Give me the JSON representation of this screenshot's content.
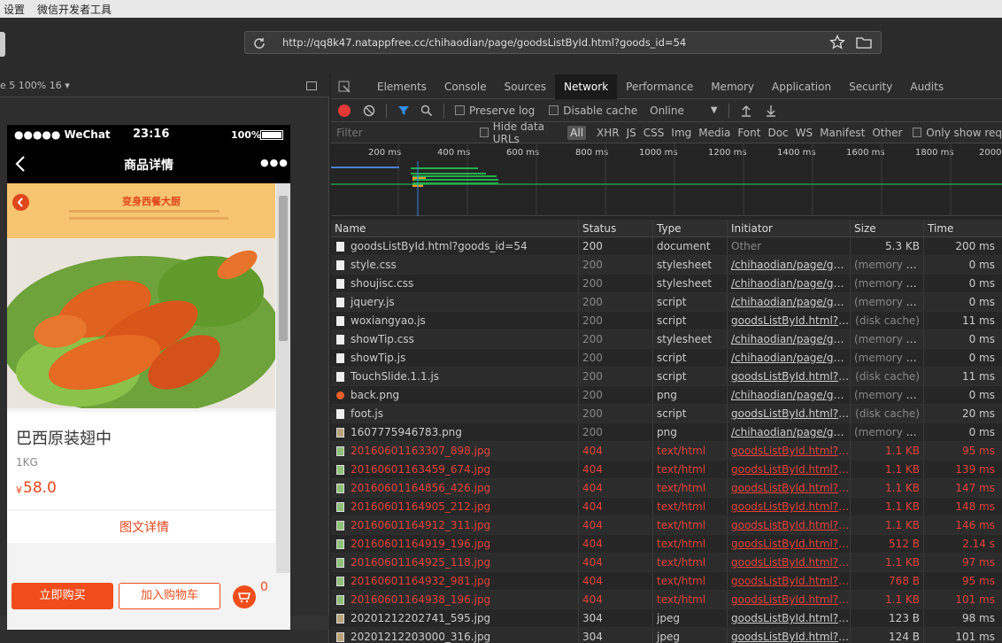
{
  "menubar": {
    "items": [
      "设置",
      "微信开发者工具"
    ]
  },
  "toolbar": {
    "url": "http://qq8k47.natappfree.cc/chihaodian/page/goodsListById.html?goods_id=54"
  },
  "simulator": {
    "device_label": "e 5 100% 16 ▾"
  },
  "phone": {
    "carrier": "●●●●● WeChat",
    "time": "23:16",
    "battery": "100%",
    "nav_title": "商品详情",
    "more": "●●●",
    "banner_title": "变身西餐大厨",
    "product_name": "巴西原装翅中",
    "product_weight": "1KG",
    "currency": "¥",
    "price": "58.0",
    "detail_link": "图文详情",
    "buy_button": "立即购买",
    "cart_button": "加入购物车",
    "cart_count": "0"
  },
  "devtools": {
    "tabs": [
      "Elements",
      "Console",
      "Sources",
      "Network",
      "Performance",
      "Memory",
      "Application",
      "Security",
      "Audits"
    ],
    "active_tab": "Network",
    "preserve_log": "Preserve log",
    "disable_cache": "Disable cache",
    "throttle": "Online",
    "filter_placeholder": "Filter",
    "hide_data_urls": "Hide data URLs",
    "all": "All",
    "types": [
      "XHR",
      "JS",
      "CSS",
      "Img",
      "Media",
      "Font",
      "Doc",
      "WS",
      "Manifest",
      "Other"
    ],
    "only_show": "Only show req",
    "ticks": [
      "200 ms",
      "400 ms",
      "600 ms",
      "800 ms",
      "1000 ms",
      "1200 ms",
      "1400 ms",
      "1600 ms",
      "1800 ms",
      "2000"
    ],
    "columns": [
      "Name",
      "Status",
      "Type",
      "Initiator",
      "Size",
      "Time"
    ],
    "rows": [
      {
        "name": "goodsListById.html?goods_id=54",
        "status": "200",
        "type": "document",
        "initiator": "Other",
        "size": "5.3 KB",
        "time": "200 ms",
        "err": false,
        "icon": "doc",
        "init_link": false,
        "dim": false
      },
      {
        "name": "style.css",
        "status": "200",
        "type": "stylesheet",
        "initiator": "/chihaodian/page/goo...",
        "size": "(memory ca...",
        "time": "0 ms",
        "err": false,
        "icon": "doc",
        "init_link": true,
        "dim": true
      },
      {
        "name": "shoujisc.css",
        "status": "200",
        "type": "stylesheet",
        "initiator": "/chihaodian/page/goo...",
        "size": "(memory ca...",
        "time": "0 ms",
        "err": false,
        "icon": "doc",
        "init_link": true,
        "dim": true
      },
      {
        "name": "jquery.js",
        "status": "200",
        "type": "script",
        "initiator": "/chihaodian/page/goo...",
        "size": "(memory ca...",
        "time": "0 ms",
        "err": false,
        "icon": "doc",
        "init_link": true,
        "dim": true
      },
      {
        "name": "woxiangyao.js",
        "status": "200",
        "type": "script",
        "initiator": "goodsListById.html?g...",
        "size": "(disk cache)",
        "time": "11 ms",
        "err": false,
        "icon": "doc",
        "init_link": true,
        "dim": true
      },
      {
        "name": "showTip.css",
        "status": "200",
        "type": "stylesheet",
        "initiator": "/chihaodian/page/goo...",
        "size": "(memory ca...",
        "time": "0 ms",
        "err": false,
        "icon": "doc",
        "init_link": true,
        "dim": true
      },
      {
        "name": "showTip.js",
        "status": "200",
        "type": "script",
        "initiator": "/chihaodian/page/goo...",
        "size": "(memory ca...",
        "time": "0 ms",
        "err": false,
        "icon": "doc",
        "init_link": true,
        "dim": true
      },
      {
        "name": "TouchSlide.1.1.js",
        "status": "200",
        "type": "script",
        "initiator": "goodsListById.html?g...",
        "size": "(disk cache)",
        "time": "11 ms",
        "err": false,
        "icon": "doc",
        "init_link": true,
        "dim": true
      },
      {
        "name": "back.png",
        "status": "200",
        "type": "png",
        "initiator": "/chihaodian/page/goo...",
        "size": "(memory ca...",
        "time": "0 ms",
        "err": false,
        "icon": "orange",
        "init_link": true,
        "dim": true
      },
      {
        "name": "foot.js",
        "status": "200",
        "type": "script",
        "initiator": "goodsListById.html?g...",
        "size": "(disk cache)",
        "time": "20 ms",
        "err": false,
        "icon": "doc",
        "init_link": true,
        "dim": true
      },
      {
        "name": "1607775946783.png",
        "status": "200",
        "type": "png",
        "initiator": "/chihaodian/page/goo...",
        "size": "(memory ca...",
        "time": "0 ms",
        "err": false,
        "icon": "img",
        "init_link": true,
        "dim": true
      },
      {
        "name": "20160601163307_898.jpg",
        "status": "404",
        "type": "text/html",
        "initiator": "goodsListById.html?g...",
        "size": "1.1 KB",
        "time": "95 ms",
        "err": true,
        "icon": "img",
        "init_link": true,
        "dim": false
      },
      {
        "name": "20160601163459_674.jpg",
        "status": "404",
        "type": "text/html",
        "initiator": "goodsListById.html?g...",
        "size": "1.1 KB",
        "time": "139 ms",
        "err": true,
        "icon": "img",
        "init_link": true,
        "dim": false
      },
      {
        "name": "20160601164856_426.jpg",
        "status": "404",
        "type": "text/html",
        "initiator": "goodsListById.html?g...",
        "size": "1.1 KB",
        "time": "147 ms",
        "err": true,
        "icon": "img",
        "init_link": true,
        "dim": false
      },
      {
        "name": "20160601164905_212.jpg",
        "status": "404",
        "type": "text/html",
        "initiator": "goodsListById.html?g...",
        "size": "1.1 KB",
        "time": "148 ms",
        "err": true,
        "icon": "img",
        "init_link": true,
        "dim": false
      },
      {
        "name": "20160601164912_311.jpg",
        "status": "404",
        "type": "text/html",
        "initiator": "goodsListById.html?g...",
        "size": "1.1 KB",
        "time": "146 ms",
        "err": true,
        "icon": "img",
        "init_link": true,
        "dim": false
      },
      {
        "name": "20160601164919_196.jpg",
        "status": "404",
        "type": "text/html",
        "initiator": "goodsListById.html?g...",
        "size": "512 B",
        "time": "2.14 s",
        "err": true,
        "icon": "img",
        "init_link": true,
        "dim": false
      },
      {
        "name": "20160601164925_118.jpg",
        "status": "404",
        "type": "text/html",
        "initiator": "goodsListById.html?g...",
        "size": "1.1 KB",
        "time": "97 ms",
        "err": true,
        "icon": "img",
        "init_link": true,
        "dim": false
      },
      {
        "name": "20160601164932_981.jpg",
        "status": "404",
        "type": "text/html",
        "initiator": "goodsListById.html?g...",
        "size": "768 B",
        "time": "95 ms",
        "err": true,
        "icon": "img",
        "init_link": true,
        "dim": false
      },
      {
        "name": "20160601164938_196.jpg",
        "status": "404",
        "type": "text/html",
        "initiator": "goodsListById.html?g...",
        "size": "1.1 KB",
        "time": "101 ms",
        "err": true,
        "icon": "img",
        "init_link": true,
        "dim": false
      },
      {
        "name": "20201212202741_595.jpg",
        "status": "304",
        "type": "jpeg",
        "initiator": "goodsListById.html?g...",
        "size": "123 B",
        "time": "98 ms",
        "err": false,
        "icon": "img",
        "init_link": true,
        "dim": false
      },
      {
        "name": "20201212203000_316.jpg",
        "status": "304",
        "type": "jpeg",
        "initiator": "goodsListById.html?g...",
        "size": "124 B",
        "time": "101 ms",
        "err": false,
        "icon": "img",
        "init_link": true,
        "dim": false
      }
    ]
  }
}
